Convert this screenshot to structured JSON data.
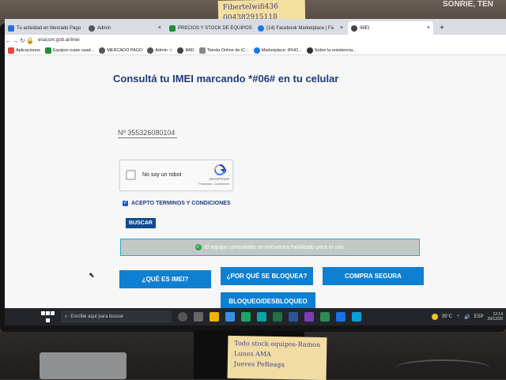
{
  "environment": {
    "sticky_top_line1": "Fibertelwifi436",
    "sticky_top_line2": "004382915118",
    "store_sign": "SONRIE, TEN",
    "sticky_bottom_lines": [
      "Todo stock equipos-Ramon",
      "Lunes AMA",
      "Jueves PeReaga"
    ]
  },
  "browser": {
    "tabs": [
      {
        "label": "Tu actividad en Mercado Pago",
        "icon": "mercadopago-icon",
        "color": "#2d6fd8"
      },
      {
        "label": "Admin",
        "icon": "browser-icon",
        "color": "#555555"
      },
      {
        "label": "PRECIOS Y STOCK DE EQUIPOS",
        "icon": "sheets-icon",
        "color": "#1b8f3a"
      },
      {
        "label": "(14) Facebook Marketplace | Fa",
        "icon": "facebook-icon",
        "color": "#1877f2"
      },
      {
        "label": "IMEI",
        "icon": "imei-icon",
        "color": "#444444"
      }
    ],
    "new_tab": "+",
    "close_glyph": "×",
    "url": "enacom.gob.ar/imei",
    "bookmarks": [
      {
        "label": "Aplicaciones",
        "icon": "apps-icon",
        "color": "#e8453c"
      },
      {
        "label": "Equipos icase usad...",
        "icon": "sheets-icon",
        "color": "#1b8f3a"
      },
      {
        "label": "MERCADO PAGO",
        "icon": "browser-icon",
        "color": "#555555"
      },
      {
        "label": "Admin ☆",
        "icon": "browser-icon",
        "color": "#555555"
      },
      {
        "label": "IMEI",
        "icon": "imei-icon",
        "color": "#444444"
      },
      {
        "label": "Tienda Online de iC...",
        "icon": "link-icon",
        "color": "#888888"
      },
      {
        "label": "Marketplace: IPHO...",
        "icon": "facebook-icon",
        "color": "#1877f2"
      },
      {
        "label": "Sobre la resistencia...",
        "icon": "apple-icon",
        "color": "#333333"
      }
    ]
  },
  "page": {
    "title": "Consultá tu IMEI marcando *#06# en tu celular",
    "imei_value": "Nº 355326080104",
    "captcha_label": "No soy un robot",
    "captcha_brand": "reCAPTCHA",
    "captcha_links": "Privacidad - Condiciones",
    "terms_label": "ACEPTO TERMINOS Y CONDICIONES",
    "terms_checked": true,
    "search_button": "BUSCAR",
    "alert_text": "El equipo consultado se encuentra habilitado para el uso.",
    "buttons": {
      "que_es": "¿QUÉ ES IMEI?",
      "por_que": "¿POR QUÉ SE BLOQUEA?",
      "compra": "COMPRA SEGURA",
      "bloqueo": "BLOQUEO/DESBLOQUEO"
    }
  },
  "taskbar": {
    "search_placeholder": "Escribe aquí para buscar",
    "weather": "35°C",
    "lang": "ESP",
    "time": "12:14",
    "date": "29/12/20"
  }
}
